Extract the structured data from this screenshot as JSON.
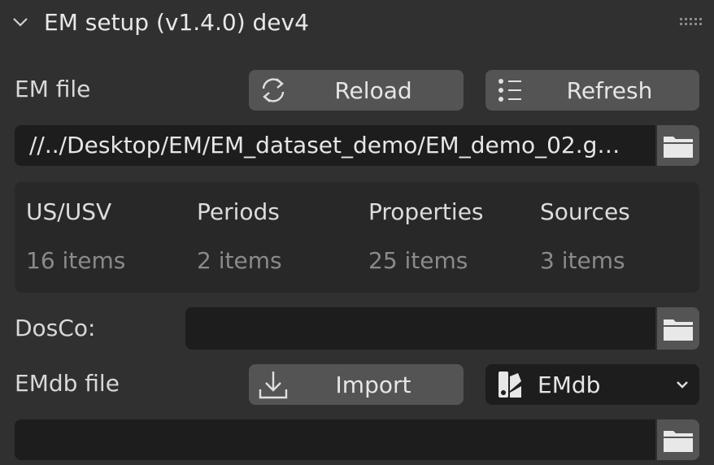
{
  "panel": {
    "title": "EM setup (v1.4.0) dev4",
    "icons": {
      "collapse": "chevron-down-icon",
      "drag": "drag-grip-icon"
    }
  },
  "em_file": {
    "label": "EM file",
    "reload_label": "Reload",
    "refresh_label": "Refresh",
    "path_value": "//../Desktop/EM/EM_dataset_demo/EM_demo_02.g…"
  },
  "stats": [
    {
      "header": "US/USV",
      "value": "16 items"
    },
    {
      "header": "Periods",
      "value": "2 items"
    },
    {
      "header": "Properties",
      "value": "25 items"
    },
    {
      "header": "Sources",
      "value": "3 items"
    }
  ],
  "dosco": {
    "label": "DosCo:",
    "value": ""
  },
  "emdb": {
    "label": "EMdb file",
    "import_label": "Import",
    "dropdown_value": "EMdb",
    "path_value": ""
  },
  "colors": {
    "panel_bg": "#303030",
    "button_bg": "#545454",
    "field_bg": "#1d1d1d",
    "stats_bg": "#282828"
  }
}
